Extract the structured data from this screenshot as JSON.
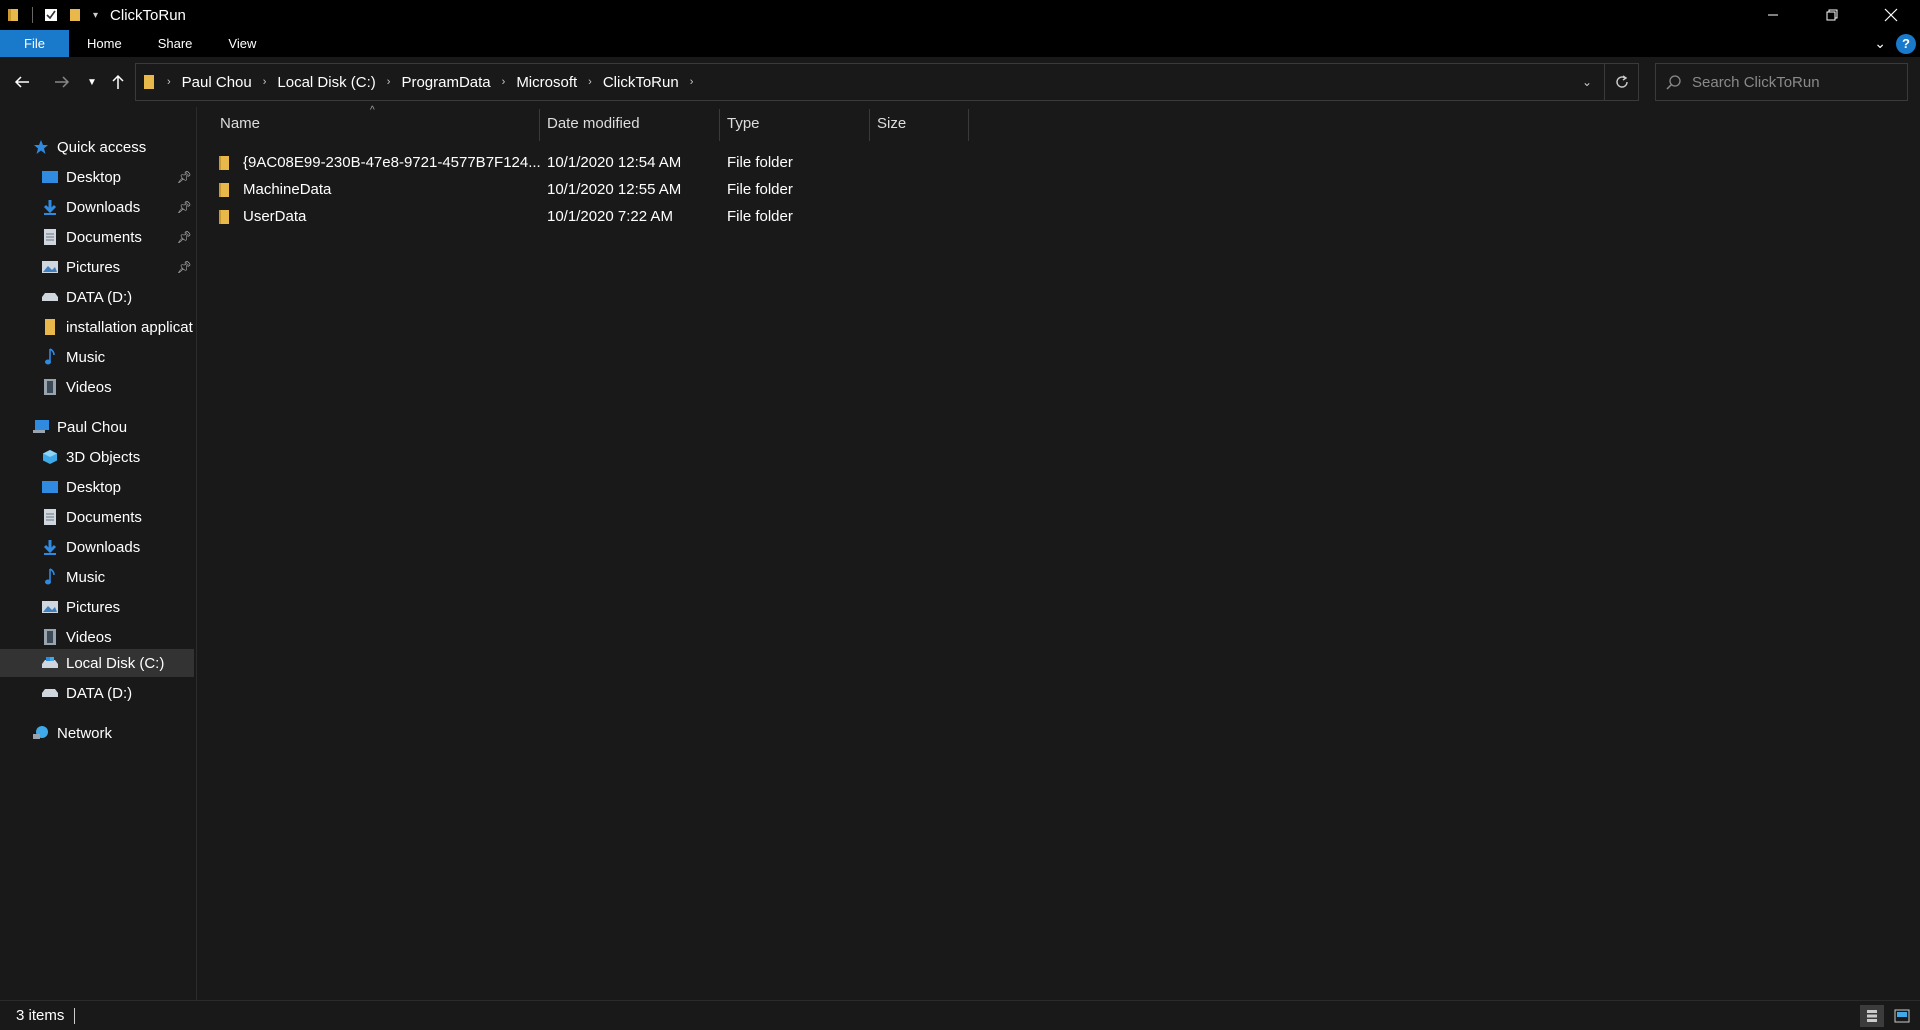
{
  "window": {
    "title": "ClickToRun"
  },
  "ribbon": {
    "tabs": [
      "File",
      "Home",
      "Share",
      "View"
    ],
    "help": "?"
  },
  "address": {
    "crumbs": [
      "Paul Chou",
      "Local Disk (C:)",
      "ProgramData",
      "Microsoft",
      "ClickToRun"
    ]
  },
  "search": {
    "placeholder": "Search ClickToRun"
  },
  "nav": {
    "quick_access": "Quick access",
    "qa_items": [
      "Desktop",
      "Downloads",
      "Documents",
      "Pictures",
      "DATA (D:)",
      "installation applicat",
      "Music",
      "Videos"
    ],
    "pc": "Paul Chou",
    "pc_items": [
      "3D Objects",
      "Desktop",
      "Documents",
      "Downloads",
      "Music",
      "Pictures",
      "Videos",
      "Local Disk (C:)",
      "DATA (D:)"
    ],
    "network": "Network"
  },
  "columns": {
    "name": "Name",
    "date": "Date modified",
    "type": "Type",
    "size": "Size"
  },
  "files": [
    {
      "name": "{9AC08E99-230B-47e8-9721-4577B7F124...",
      "date": "10/1/2020 12:54 AM",
      "type": "File folder"
    },
    {
      "name": "MachineData",
      "date": "10/1/2020 12:55 AM",
      "type": "File folder"
    },
    {
      "name": "UserData",
      "date": "10/1/2020 7:22 AM",
      "type": "File folder"
    }
  ],
  "status": {
    "count": "3 items"
  },
  "colors": {
    "accent": "#1979ca",
    "folder": "#e8b84a",
    "background": "#191919",
    "selection": "#333333"
  }
}
